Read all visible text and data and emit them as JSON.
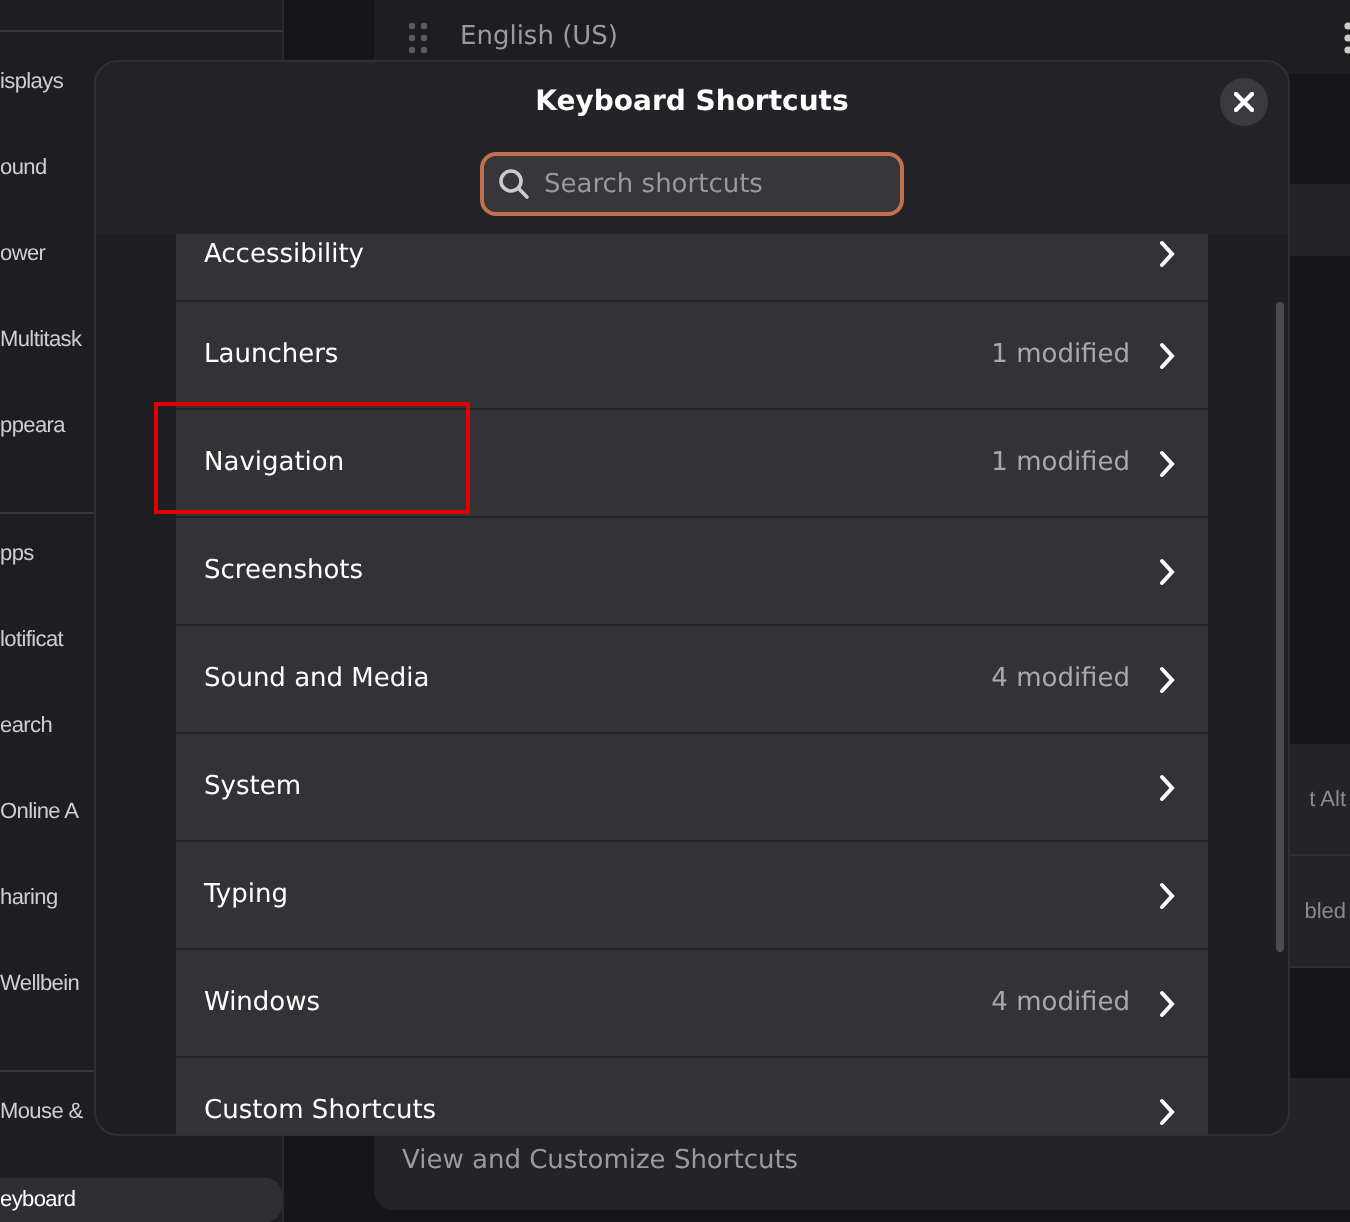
{
  "sidebar": {
    "groups": [
      [
        {
          "label": "isplays",
          "selected": false
        },
        {
          "label": "ound",
          "selected": false
        },
        {
          "label": "ower",
          "selected": false
        },
        {
          "label": "Multitask",
          "selected": false
        },
        {
          "label": "ppeara",
          "selected": false
        }
      ],
      [
        {
          "label": "pps",
          "selected": false
        },
        {
          "label": "lotificat",
          "selected": false
        },
        {
          "label": "earch",
          "selected": false
        },
        {
          "label": "Online A",
          "selected": false
        },
        {
          "label": "haring",
          "selected": false
        },
        {
          "label": "Wellbein",
          "selected": false
        }
      ],
      [
        {
          "label": "Mouse &",
          "selected": false
        },
        {
          "label": "eyboard",
          "selected": true
        }
      ]
    ]
  },
  "background_panel": {
    "input_source": "English (US)",
    "row_values": [
      "t Alt",
      "bled"
    ],
    "footer": "View and Customize Shortcuts"
  },
  "dialog": {
    "title": "Keyboard Shortcuts",
    "search": {
      "placeholder": "Search shortcuts"
    },
    "categories": [
      {
        "label": "Accessibility",
        "highlighted": false
      },
      {
        "label": "Launchers",
        "status": "1 modified",
        "highlighted": false
      },
      {
        "label": "Navigation",
        "status": "1 modified",
        "highlighted": true
      },
      {
        "label": "Screenshots",
        "highlighted": false
      },
      {
        "label": "Sound and Media",
        "status": "4 modified",
        "highlighted": false
      },
      {
        "label": "System",
        "highlighted": false
      },
      {
        "label": "Typing",
        "highlighted": false
      },
      {
        "label": "Windows",
        "status": "4 modified",
        "highlighted": false
      },
      {
        "label": "Custom Shortcuts",
        "highlighted": false
      }
    ]
  }
}
